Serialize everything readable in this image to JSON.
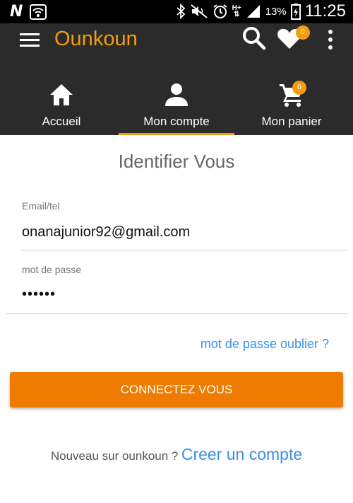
{
  "status_bar": {
    "carrier_logo": "N",
    "network_type": "H+",
    "battery_percent": "13%",
    "time": "11:25",
    "icons": [
      "wifi-icon",
      "bluetooth-icon",
      "mute-icon",
      "alarm-icon",
      "signal-icon",
      "battery-icon"
    ]
  },
  "app_bar": {
    "title": "Ounkoun",
    "wishlist_count": "0",
    "brand_color": "#f39c12"
  },
  "tabs": [
    {
      "label": "Accueil",
      "icon": "home-icon",
      "active": false
    },
    {
      "label": "Mon compte",
      "icon": "account-icon",
      "active": true
    },
    {
      "label": "Mon panier",
      "icon": "cart-icon",
      "active": false,
      "badge": "0"
    }
  ],
  "form": {
    "title": "Identifier Vous",
    "email_label": "Email/tel",
    "email_value": "onanajunior92@gmail.com",
    "password_label": "mot de passe",
    "password_value": "••••••",
    "forgot_link": "mot de passe oublier ?",
    "submit_label": "CONNECTEZ VOUS"
  },
  "signup": {
    "text": "Nouveau sur ounkoun ?",
    "link": "Creer un compte"
  }
}
